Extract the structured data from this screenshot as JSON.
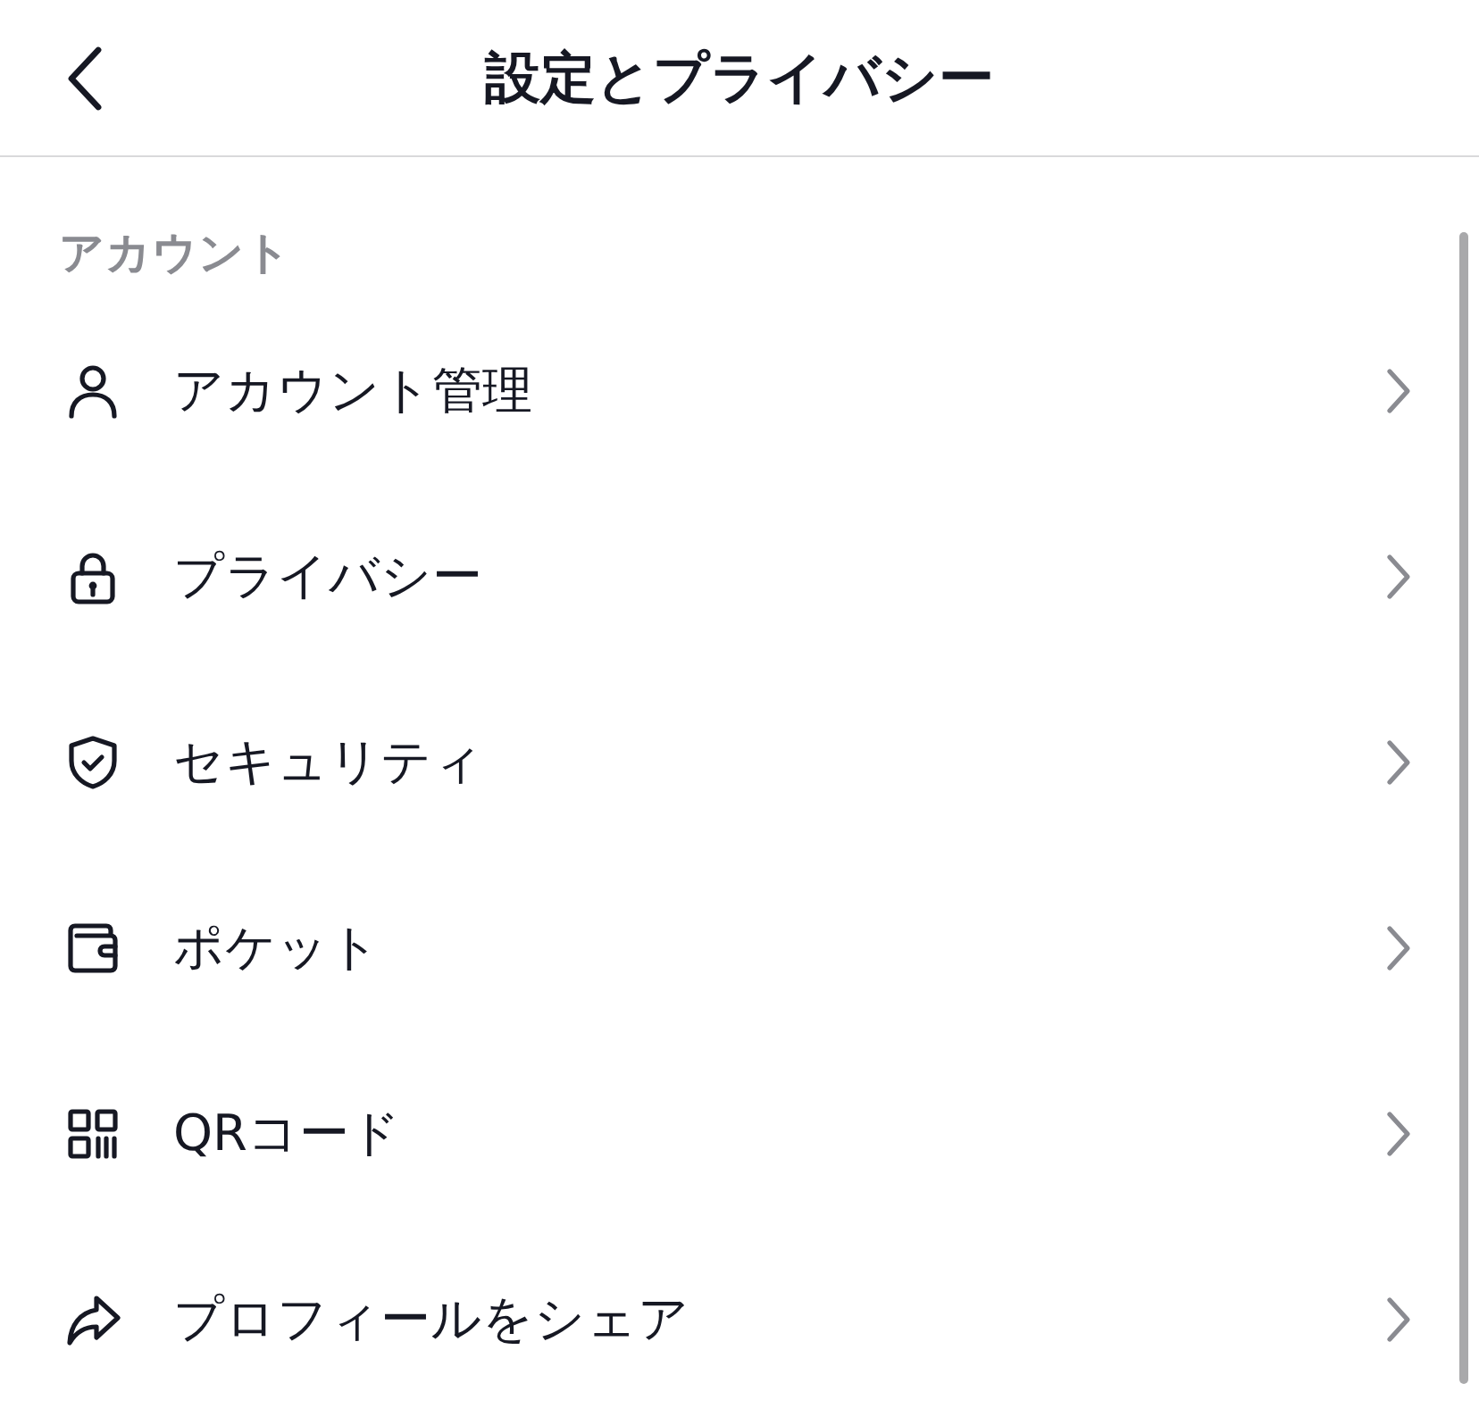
{
  "header": {
    "title": "設定とプライバシー"
  },
  "section": {
    "title": "アカウント"
  },
  "items": [
    {
      "label": "アカウント管理"
    },
    {
      "label": "プライバシー"
    },
    {
      "label": "セキュリティ"
    },
    {
      "label": "ポケット"
    },
    {
      "label": "QRコード"
    },
    {
      "label": "プロフィールをシェア"
    }
  ]
}
